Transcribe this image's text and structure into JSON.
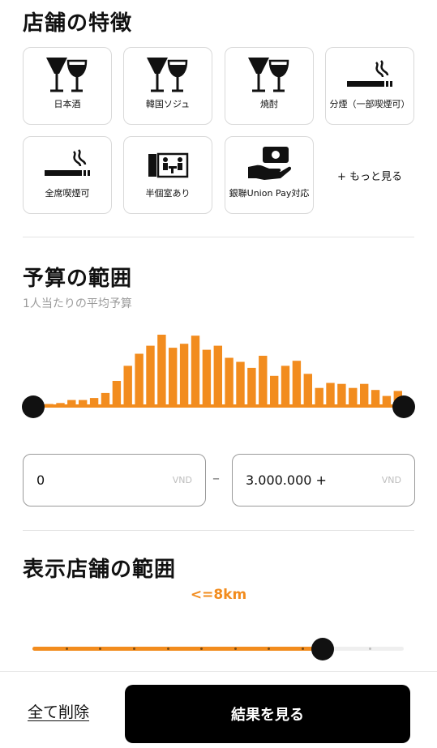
{
  "features": {
    "title": "店舗の特徴",
    "items": [
      {
        "label": "日本酒",
        "icon": "wine-glasses-icon"
      },
      {
        "label": "韓国ソジュ",
        "icon": "wine-glasses-icon"
      },
      {
        "label": "焼酎",
        "icon": "wine-glasses-icon"
      },
      {
        "label": "分煙（一部喫煙可）",
        "icon": "cigarette-icon"
      },
      {
        "label": "全席喫煙可",
        "icon": "cigarette-icon"
      },
      {
        "label": "半個室あり",
        "icon": "private-room-icon"
      },
      {
        "label": "銀聯Union Pay対応",
        "icon": "card-payment-icon"
      }
    ],
    "more_label": "+ もっと見る"
  },
  "budget": {
    "title": "予算の範囲",
    "subtitle": "1人当たりの平均予算",
    "histogram": [
      2,
      2,
      3,
      6,
      6,
      8,
      13,
      25,
      40,
      52,
      60,
      71,
      58,
      62,
      70,
      56,
      60,
      48,
      44,
      38,
      50,
      30,
      40,
      45,
      32,
      18,
      23,
      22,
      18,
      22,
      16,
      10,
      15
    ],
    "min": {
      "value": "0",
      "unit": "VND"
    },
    "max": {
      "value": "3.000.000 +",
      "unit": "VND"
    },
    "separator": "–"
  },
  "distance": {
    "title": "表示店舗の範囲",
    "value_label": "<=8km",
    "steps": 11,
    "selected_step": 9
  },
  "footer": {
    "clear_label": "全て削除",
    "results_label": "結果を見る"
  },
  "colors": {
    "accent": "#f28c1e",
    "button_bg": "#000000"
  }
}
